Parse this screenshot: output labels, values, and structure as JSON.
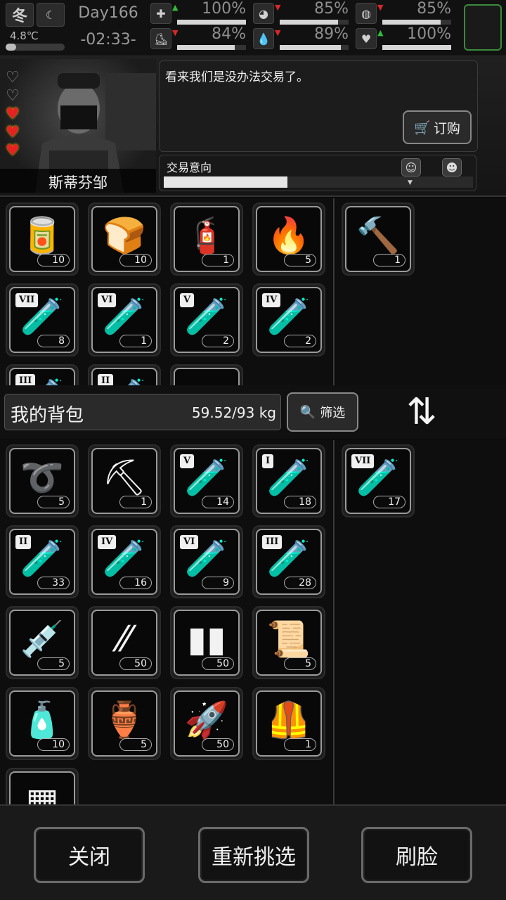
{
  "status": {
    "season": "冬",
    "temperature": "4.8℃",
    "day": "Day166",
    "time": "-02:33-",
    "stats": [
      {
        "icon": "medkit-icon",
        "glyph": "✚",
        "trend": "up",
        "value": "100%",
        "fill": 1.0
      },
      {
        "icon": "stomach-icon",
        "glyph": "◕",
        "trend": "down",
        "value": "85%",
        "fill": 0.85
      },
      {
        "icon": "bladder-icon",
        "glyph": "◍",
        "trend": "down",
        "value": "85%",
        "fill": 0.85
      },
      {
        "icon": "boot-icon",
        "glyph": "⛸",
        "trend": "down",
        "value": "84%",
        "fill": 0.84
      },
      {
        "icon": "water-drop-icon",
        "glyph": "💧",
        "trend": "down",
        "value": "89%",
        "fill": 0.89
      },
      {
        "icon": "heart-icon",
        "glyph": "♥",
        "trend": "up",
        "value": "100%",
        "fill": 1.0
      }
    ]
  },
  "trader": {
    "name": "斯蒂芬邹",
    "hearts": [
      "empty",
      "empty",
      "full",
      "full",
      "full"
    ],
    "dialog": "看来我们是没办法交易了。",
    "order_label": "订购",
    "intent_label": "交易意向",
    "intent_level": 0.4
  },
  "trader_items": [
    {
      "name": "canned-food",
      "glyph": "🥫",
      "count": "10"
    },
    {
      "name": "bread",
      "glyph": "🍞",
      "count": "10"
    },
    {
      "name": "flamethrower-tanks",
      "glyph": "🧯",
      "count": "1"
    },
    {
      "name": "fuel-pack",
      "glyph": "🔥",
      "count": "5"
    },
    {
      "name": "test-tube",
      "tier": "VII",
      "glyph": "🧪",
      "count": "8"
    },
    {
      "name": "test-tube",
      "tier": "VI",
      "glyph": "🧪",
      "count": "1"
    },
    {
      "name": "test-tube",
      "tier": "V",
      "glyph": "🧪",
      "count": "2"
    },
    {
      "name": "test-tube",
      "tier": "IV",
      "glyph": "🧪",
      "count": "2"
    },
    {
      "name": "test-tube",
      "tier": "III",
      "glyph": "🧪",
      "count": ""
    },
    {
      "name": "test-tube",
      "tier": "II",
      "glyph": "🧪",
      "count": ""
    },
    {
      "name": "crate",
      "glyph": "▦",
      "count": ""
    }
  ],
  "trader_offer": [
    {
      "name": "golden-hammer",
      "glyph": "🔨",
      "count": "1"
    }
  ],
  "backpack": {
    "title": "我的背包",
    "weight": "59.52/93 kg",
    "filter_label": "筛选"
  },
  "my_items": [
    {
      "name": "rope",
      "glyph": "➰",
      "count": "5"
    },
    {
      "name": "shovel",
      "glyph": "⛏",
      "count": "1"
    },
    {
      "name": "test-tube",
      "tier": "V",
      "glyph": "🧪",
      "count": "14"
    },
    {
      "name": "test-tube",
      "tier": "I",
      "glyph": "🧪",
      "count": "18"
    },
    {
      "name": "test-tube",
      "tier": "II",
      "glyph": "🧪",
      "count": "33"
    },
    {
      "name": "test-tube",
      "tier": "IV",
      "glyph": "🧪",
      "count": "16"
    },
    {
      "name": "test-tube",
      "tier": "VI",
      "glyph": "🧪",
      "count": "9"
    },
    {
      "name": "test-tube",
      "tier": "III",
      "glyph": "🧪",
      "count": "28"
    },
    {
      "name": "syringe",
      "glyph": "💉",
      "count": "5"
    },
    {
      "name": "rifle-bullets",
      "glyph": "⁄⁄",
      "count": "50"
    },
    {
      "name": "shotgun-shells",
      "glyph": "▮▮",
      "count": "50"
    },
    {
      "name": "cloth-scraps",
      "glyph": "📜",
      "count": "5"
    },
    {
      "name": "spray-bottles",
      "glyph": "🧴",
      "count": "10"
    },
    {
      "name": "vase",
      "glyph": "🏺",
      "count": "5"
    },
    {
      "name": "rocket",
      "glyph": "🚀",
      "count": "50"
    },
    {
      "name": "body-armor",
      "glyph": "🦺",
      "count": "1"
    },
    {
      "name": "battery",
      "glyph": "▦",
      "count": ""
    }
  ],
  "my_offer": [
    {
      "name": "test-tube",
      "tier": "VII",
      "glyph": "🧪",
      "count": "17"
    }
  ],
  "footer": {
    "close_label": "关闭",
    "reselect_label": "重新挑选",
    "refresh_label": "刷脸"
  }
}
